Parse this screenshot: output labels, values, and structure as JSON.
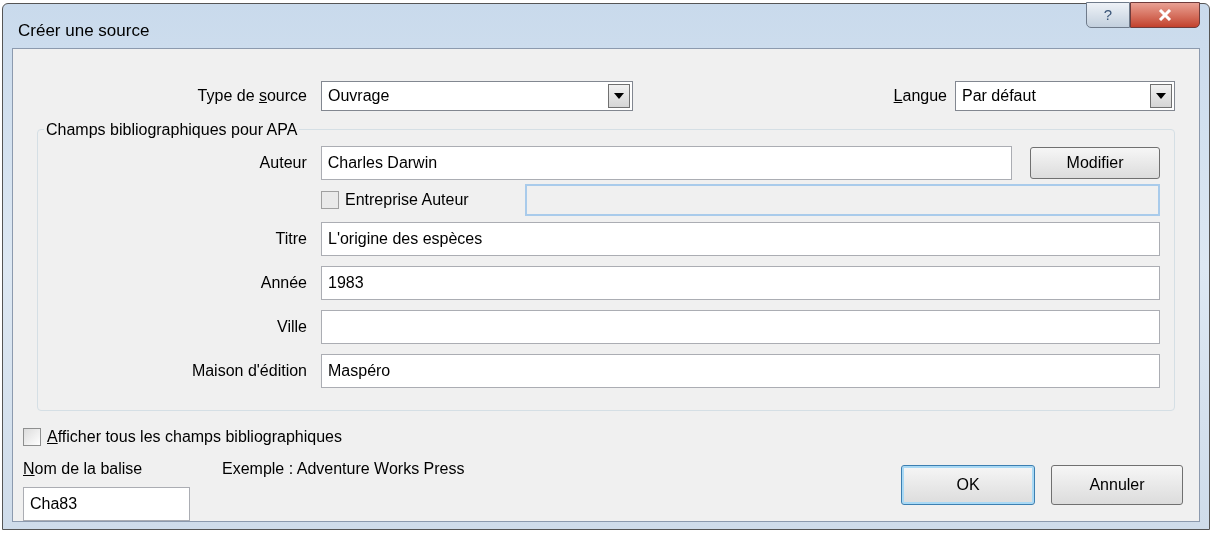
{
  "window": {
    "title": "Créer une source",
    "help_button": "?"
  },
  "type_de_source": {
    "label": [
      {
        "text": "Type de ",
        "underline": false
      },
      {
        "text": "s",
        "underline": true
      },
      {
        "text": "ource",
        "underline": false
      }
    ],
    "value": "Ouvrage"
  },
  "langue": {
    "label": [
      {
        "text": "L",
        "underline": true
      },
      {
        "text": "angue",
        "underline": false
      }
    ],
    "value": "Par défaut"
  },
  "group": {
    "title": "Champs bibliographiques pour APA",
    "fields": [
      {
        "label": "Auteur",
        "value": "Charles Darwin",
        "button": "Modifier"
      },
      {
        "label": "Titre",
        "value": "L'origine des espèces"
      },
      {
        "label": "Année",
        "value": "1983"
      },
      {
        "label": "Ville"
      },
      {
        "label": "Maison d'édition",
        "value": "Maspéro"
      }
    ],
    "corporate_author": {
      "label": "Entreprise Auteur",
      "checked": false,
      "disabled": true
    }
  },
  "show_all": {
    "label": [
      {
        "text": "A",
        "underline": true
      },
      {
        "text": "fficher tous les champs bibliographiques",
        "underline": false
      }
    ],
    "checked": false
  },
  "tag_name": {
    "label": [
      {
        "text": "N",
        "underline": true
      },
      {
        "text": "om de la balise",
        "underline": false
      }
    ],
    "value": "Cha83"
  },
  "example": "Exemple : Adventure Works Press",
  "buttons": [
    {
      "label": "OK",
      "default": true
    },
    {
      "label": "Annuler",
      "default": false
    }
  ]
}
